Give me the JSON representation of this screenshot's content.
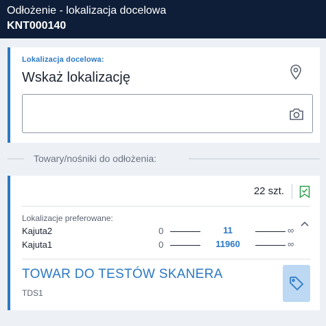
{
  "header": {
    "title": "Odłożenie - lokalizacja docelowa",
    "document_number": "KNT000140"
  },
  "target_location": {
    "label": "Lokalizacja docelowa:",
    "prompt": "Wskaż lokalizację",
    "input_value": "",
    "pin_icon": "map-pin-icon",
    "camera_icon": "camera-icon"
  },
  "section": {
    "label": "Towary/nośniki do odłożenia:"
  },
  "item": {
    "quantity": "22 szt.",
    "check_icon": "bookmark-check-icon",
    "preferred_label": "Lokalizacje preferowane:",
    "preferred_locations": [
      {
        "name": "Kajuta2",
        "min": "0",
        "value": "11",
        "max": "∞"
      },
      {
        "name": "Kajuta1",
        "min": "0",
        "value": "11960",
        "max": "∞"
      }
    ],
    "product_name": "TOWAR DO TESTÓW SKANERA",
    "product_code": "TDS1",
    "tag_icon": "tag-icon",
    "colors": {
      "accent": "#2b78c4",
      "tag_bg": "#bcd8f2",
      "check": "#2e9e4a"
    }
  }
}
